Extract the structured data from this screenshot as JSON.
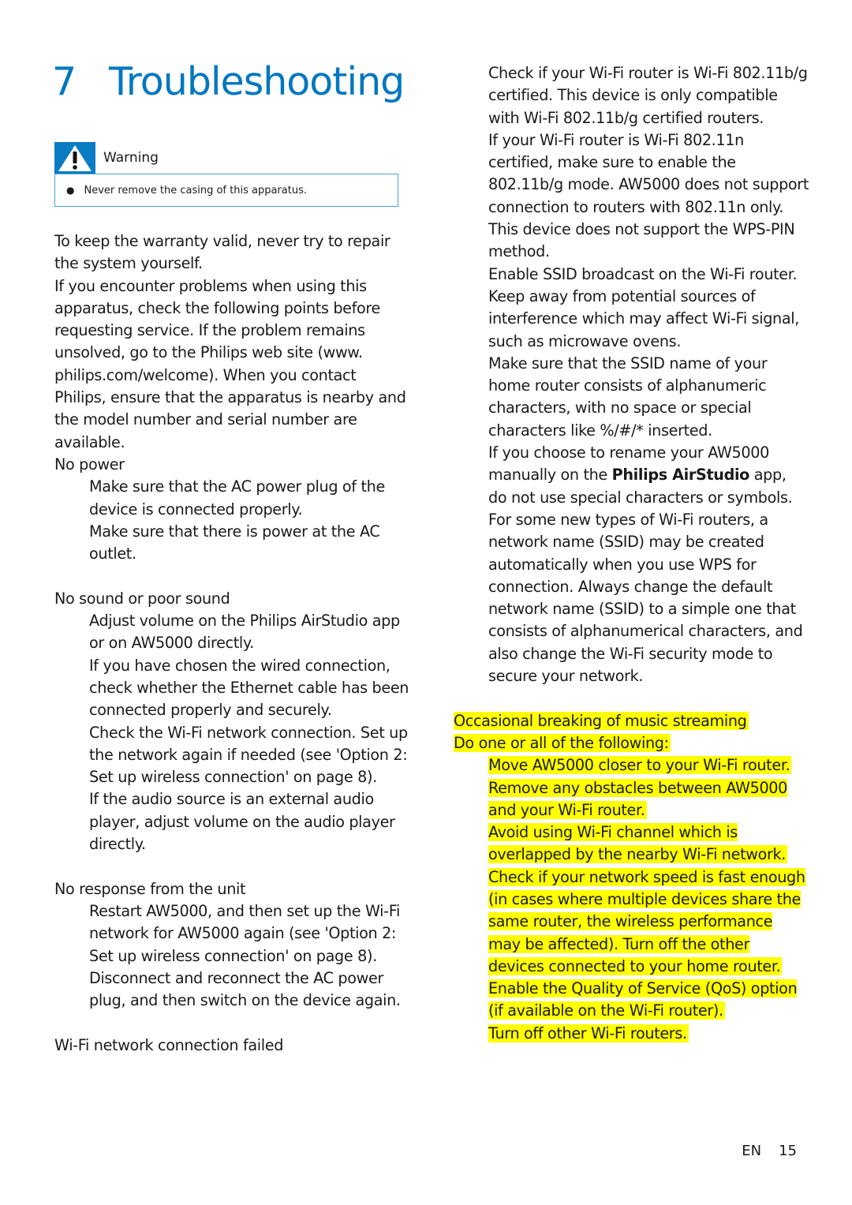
{
  "title": {
    "number": "7",
    "text": "Troubleshooting"
  },
  "warning": {
    "icon": "warning-triangle-icon",
    "label": "Warning",
    "items": [
      "Never remove the casing of this apparatus."
    ]
  },
  "intro": [
    "To keep the warranty valid, never try to repair the system yourself.",
    "If you encounter problems when using this apparatus, check the following points before requesting service. If the problem remains unsolved, go to the Philips web site (www. philips.com/welcome). When you contact Philips, ensure that the apparatus is nearby and the model number and serial number are available."
  ],
  "sections": [
    {
      "heading": "No power",
      "items": [
        "Make sure that the AC power plug of the device is connected properly.",
        "Make sure that there is power at the AC outlet."
      ]
    },
    {
      "heading": "No sound or poor sound",
      "items": [
        "Adjust volume on the Philips AirStudio app or on AW5000 directly.",
        "If you have chosen the wired connection, check whether the Ethernet cable has been connected properly and securely.",
        "Check the Wi-Fi network connection. Set up the network again if needed (see 'Option 2: Set up wireless connection' on page 8).",
        "If the audio source is an external audio player, adjust volume on the audio player directly."
      ]
    },
    {
      "heading": "No response from the unit",
      "items": [
        "Restart AW5000, and then set up the Wi-Fi network for AW5000 again (see 'Option 2: Set up wireless connection' on page 8).",
        "Disconnect and reconnect the AC power plug, and then switch on the device again."
      ]
    },
    {
      "heading": "Wi-Fi network connection failed",
      "items": [
        "Check if your Wi-Fi router is Wi-Fi 802.11b/g certified. This device is only compatible with Wi-Fi 802.11b/g certified routers.",
        "If your Wi-Fi router is Wi-Fi 802.11n certified, make sure to enable the 802.11b/g mode. AW5000 does not support connection to routers with 802.11n only.",
        "This device does not support the WPS-PIN method.",
        "Enable SSID broadcast on the Wi-Fi router.",
        "Keep away from potential sources of interference which may affect Wi-Fi signal, such as microwave ovens.",
        "Make sure that the SSID name of your home router consists of alphanumeric characters, with no space or special characters like %/#/* inserted.",
        {
          "before": "If you choose to rename your AW5000 manually on the ",
          "brand": "Philips AirStudio",
          "after": " app, do not use special characters or symbols."
        },
        "For some new types of Wi-Fi routers, a network name (SSID) may be created automatically when you use WPS for connection. Always change the default network name (SSID) to a simple one that consists of alphanumerical characters, and also change the Wi-Fi security mode to secure your network."
      ]
    },
    {
      "heading": "Occasional breaking of music streaming",
      "subheading": "Do one or all of the following:",
      "highlighted": true,
      "highlight_color": "#ffff00",
      "items": [
        "Move AW5000 closer to your Wi-Fi router.",
        "Remove any obstacles between AW5000 and your Wi-Fi router.",
        "Avoid using Wi-Fi channel which is overlapped by the nearby Wi-Fi network.",
        "Check if your network speed is fast enough (in cases where multiple devices share the same router, the wireless performance may be affected). Turn off the other devices connected to your home router.",
        "Enable the Quality of Service (QoS) option (if available on the Wi-Fi router).",
        "Turn off other Wi-Fi routers."
      ]
    }
  ],
  "footer": {
    "language": "EN",
    "page": "15"
  },
  "colors": {
    "accent": "#0077c0",
    "warning_box_border": "#4aa3d6",
    "highlight": "#ffff00"
  }
}
